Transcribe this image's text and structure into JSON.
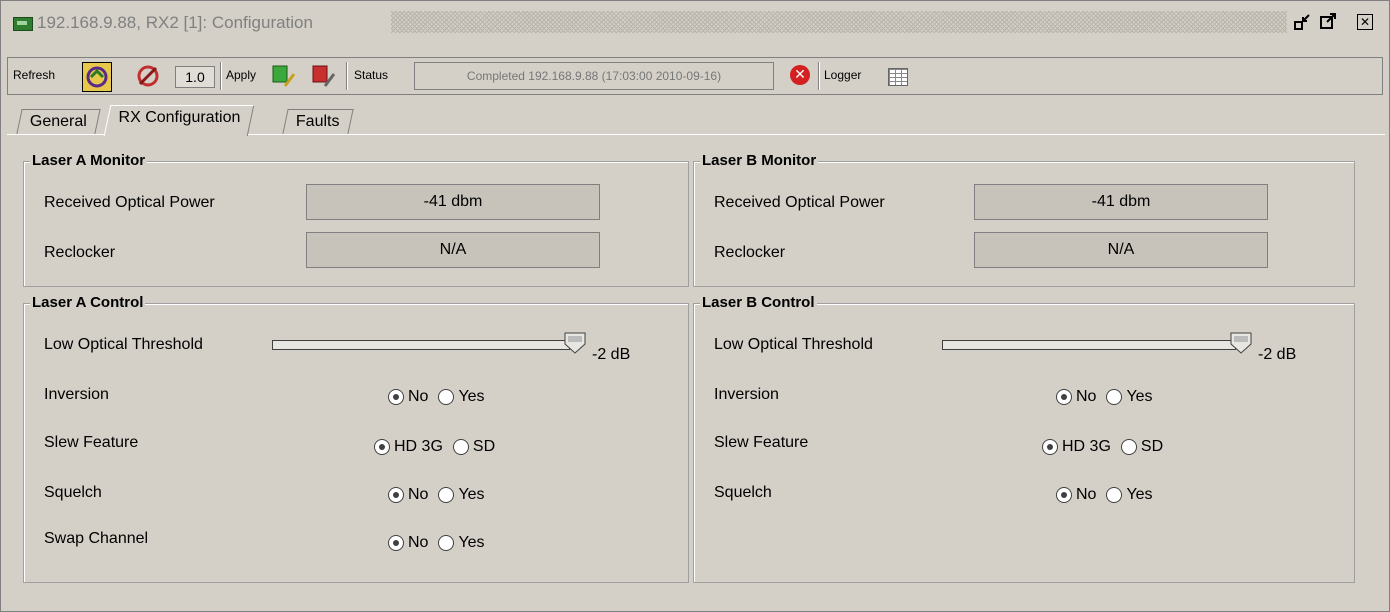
{
  "window": {
    "title": "192.168.9.88, RX2  [1]: Configuration",
    "controls": [
      "minimize-icon",
      "maximize-icon",
      "close-icon"
    ]
  },
  "toolbar": {
    "refresh_label": "Refresh",
    "refresh_value": "1.0",
    "apply_label": "Apply",
    "status_label": "Status",
    "status_text": "Completed 192.168.9.88 (17:03:00  2010-09-16)",
    "logger_label": "Logger"
  },
  "tabs": [
    {
      "label": "General",
      "active": false
    },
    {
      "label": "RX Configuration",
      "active": true
    },
    {
      "label": "Faults",
      "active": false
    }
  ],
  "laser_a_monitor": {
    "title": "Laser A Monitor",
    "power_label": "Received Optical Power",
    "power_value": "-41 dbm",
    "reclocker_label": "Reclocker",
    "reclocker_value": "N/A"
  },
  "laser_b_monitor": {
    "title": "Laser B Monitor",
    "power_label": "Received Optical Power",
    "power_value": "-41 dbm",
    "reclocker_label": "Reclocker",
    "reclocker_value": "N/A"
  },
  "laser_a_control": {
    "title": "Laser A Control",
    "threshold_label": "Low Optical Threshold",
    "threshold_value": "-2 dB",
    "threshold_level": 1.0,
    "inversion_label": "Inversion",
    "inversion_options": [
      "No",
      "Yes"
    ],
    "inversion_selected": "No",
    "slew_label": "Slew Feature",
    "slew_options": [
      "HD 3G",
      "SD"
    ],
    "slew_selected": "HD 3G",
    "squelch_label": "Squelch",
    "squelch_options": [
      "No",
      "Yes"
    ],
    "squelch_selected": "No",
    "swap_label": "Swap Channel",
    "swap_options": [
      "No",
      "Yes"
    ],
    "swap_selected": "No"
  },
  "laser_b_control": {
    "title": "Laser B Control",
    "threshold_label": "Low Optical Threshold",
    "threshold_value": "-2 dB",
    "threshold_level": 1.0,
    "inversion_label": "Inversion",
    "inversion_options": [
      "No",
      "Yes"
    ],
    "inversion_selected": "No",
    "slew_label": "Slew Feature",
    "slew_options": [
      "HD 3G",
      "SD"
    ],
    "slew_selected": "HD 3G",
    "squelch_label": "Squelch",
    "squelch_options": [
      "No",
      "Yes"
    ],
    "squelch_selected": "No"
  }
}
